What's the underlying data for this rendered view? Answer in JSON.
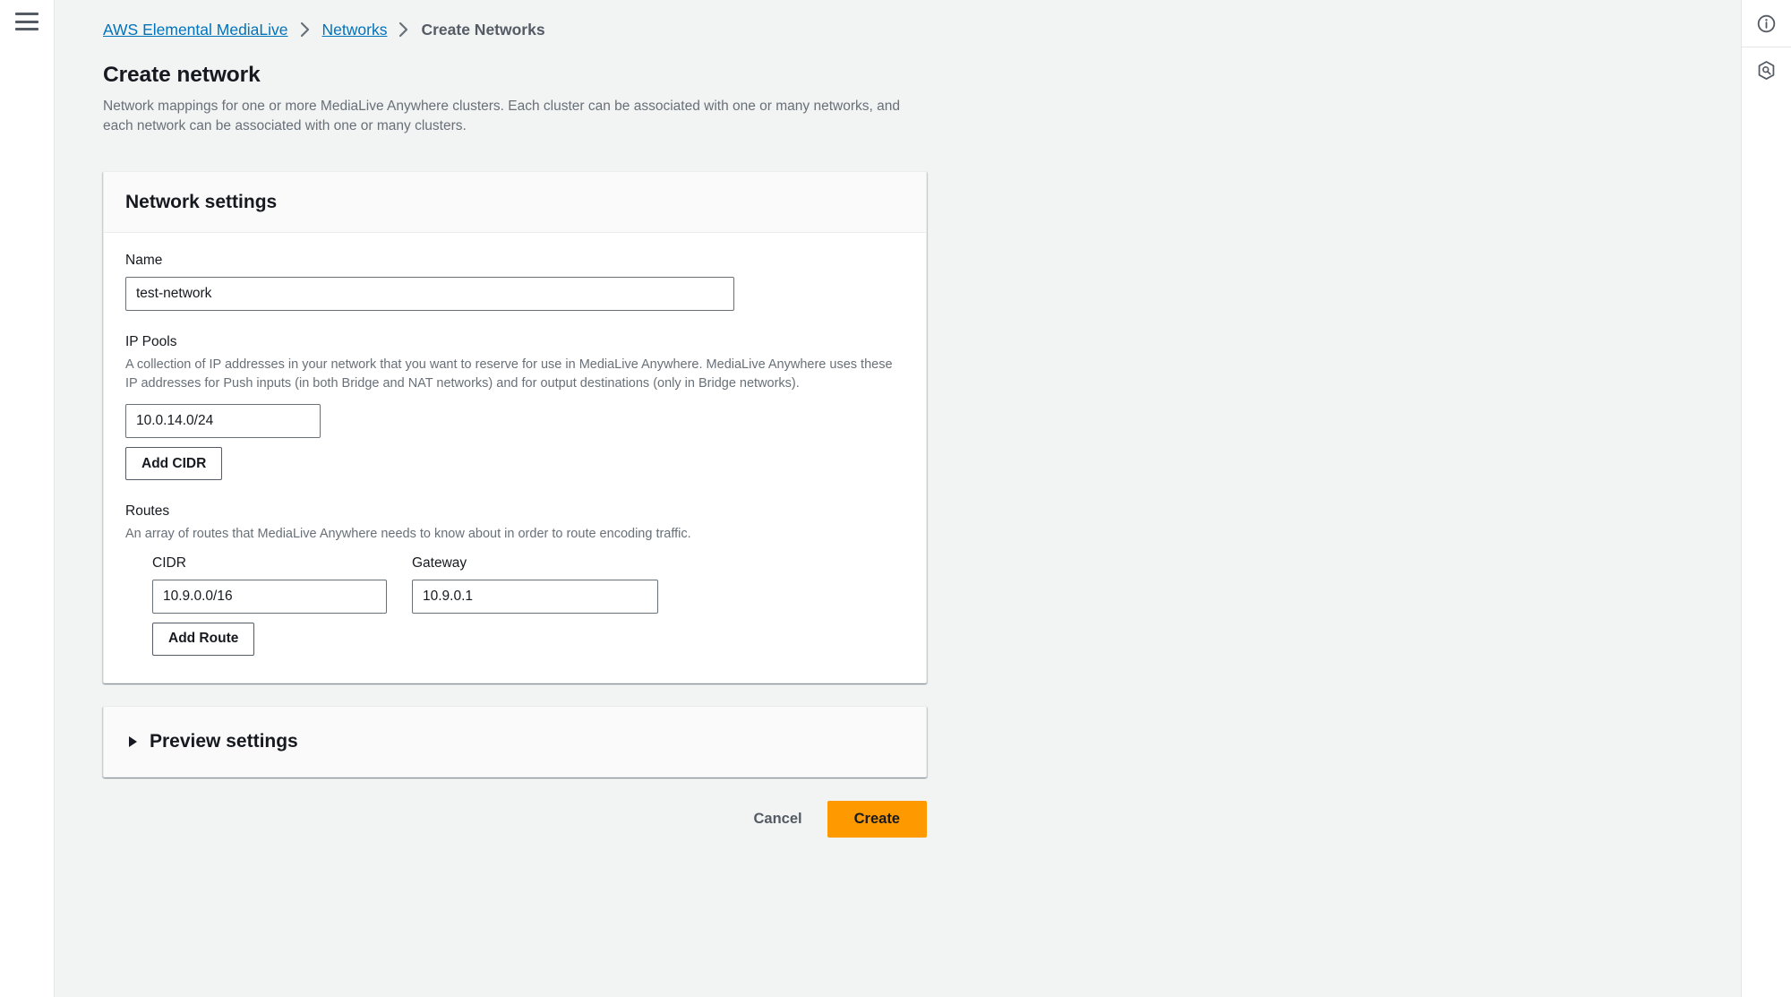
{
  "left_rail": {
    "menu_icon": "hamburger-menu-icon"
  },
  "breadcrumb": {
    "items": [
      {
        "label": "AWS Elemental MediaLive",
        "type": "link"
      },
      {
        "label": "Networks",
        "type": "link"
      },
      {
        "label": "Create Networks",
        "type": "current"
      }
    ]
  },
  "page": {
    "title": "Create network",
    "description": "Network mappings for one or more MediaLive Anywhere clusters. Each cluster can be associated with one or many networks, and each network can be associated with one or many clusters."
  },
  "network_settings": {
    "header": "Network settings",
    "name": {
      "label": "Name",
      "value": "test-network",
      "placeholder": ""
    },
    "ip_pools": {
      "label": "IP Pools",
      "description": "A collection of IP addresses in your network that you want to reserve for use in MediaLive Anywhere. MediaLive Anywhere uses these IP addresses for Push inputs (in both Bridge and NAT networks) and for output destinations (only in Bridge networks).",
      "cidr_value": "10.0.14.0/24",
      "cidr_placeholder": "",
      "add_button": "Add CIDR"
    },
    "routes": {
      "label": "Routes",
      "description": "An array of routes that MediaLive Anywhere needs to know about in order to route encoding traffic.",
      "columns": {
        "cidr": "CIDR",
        "gateway": "Gateway"
      },
      "rows": [
        {
          "cidr": "10.9.0.0/16",
          "gateway": "10.9.0.1"
        }
      ],
      "cidr_placeholder": "",
      "gateway_placeholder": "",
      "add_button": "Add Route"
    }
  },
  "preview_settings": {
    "label": "Preview settings",
    "expanded": false,
    "caret_icon": "caret-right-icon"
  },
  "footer": {
    "cancel_label": "Cancel",
    "create_label": "Create"
  },
  "right_rail": {
    "items": [
      {
        "icon": "info-circle-icon"
      },
      {
        "icon": "shield-search-icon"
      }
    ]
  },
  "colors": {
    "accent_orange": "#ff9900",
    "link_blue": "#0073bb",
    "page_background": "#f2f3f3",
    "card_background": "#ffffff",
    "card_header_background": "#fafafa",
    "text_primary": "#16191f",
    "text_secondary": "#687078"
  }
}
